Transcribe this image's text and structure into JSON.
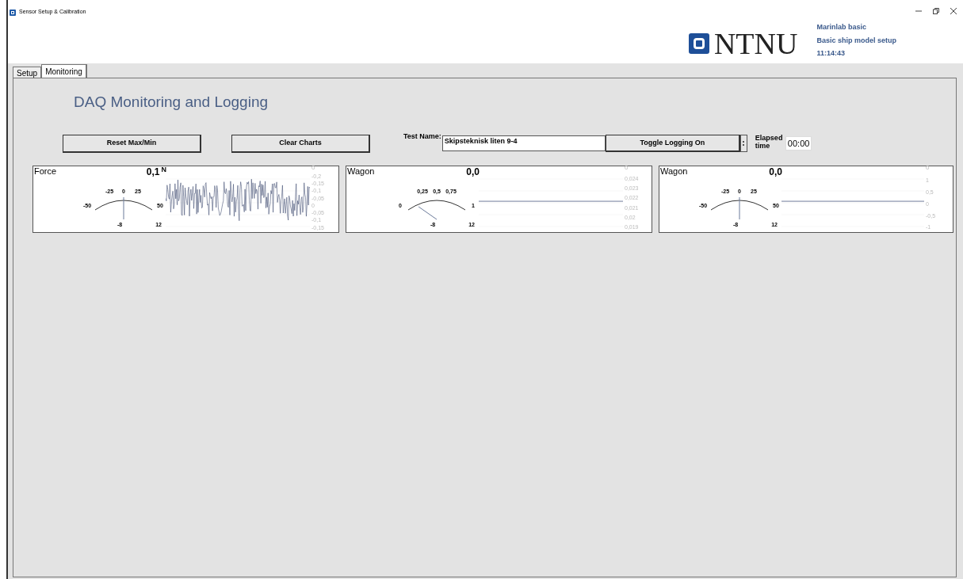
{
  "window": {
    "title": "Sensor Setup & Calibration"
  },
  "header": {
    "logo_text": "NTNU",
    "info": [
      "Marinlab basic",
      "Basic ship model setup",
      "11:14:43"
    ]
  },
  "tabs": [
    {
      "label": "Setup",
      "selected": false
    },
    {
      "label": "Monitoring",
      "selected": true
    }
  ],
  "page_title": "DAQ Monitoring and Logging",
  "toolbar": {
    "buttons": [
      "Reset Max/Min",
      "Clear Charts"
    ],
    "test_name_label": "Test Name:",
    "test_name_value": "Skipsteknisk liten 9-4",
    "toggle_button": "Toggle Logging On",
    "elapsed_label": "Elapsed time",
    "elapsed_value": "00:00"
  },
  "monitors": [
    {
      "title": "Force",
      "value": "0,1",
      "unit": "N",
      "gauge_ticks": [
        "-50",
        "-25",
        "0",
        "25",
        "50"
      ],
      "min": "-8",
      "max": "12",
      "corner_label": "0",
      "axis_labels": [
        "-0,2",
        "-0,15",
        "-0,1",
        "-0,05",
        "0",
        "-0,05",
        "-0,1",
        "-0,15"
      ],
      "kind": "live"
    },
    {
      "title": "Wagon",
      "value": "0,0",
      "gauge_ticks": [
        "0",
        "0,25",
        "0,5",
        "0,75",
        "1"
      ],
      "min": "-8",
      "max": "12",
      "corner_label": "0",
      "axis_labels": [
        "0,024",
        "0,023",
        "0,022",
        "0,021",
        "0,02",
        "0,019"
      ],
      "kind": "unsigned"
    },
    {
      "title": "Wagon",
      "value": "0,0",
      "gauge_ticks": [
        "-50",
        "-25",
        "0",
        "25",
        "50"
      ],
      "min": "-8",
      "max": "12",
      "corner_label": "0",
      "axis_labels": [
        "1",
        "0,5",
        "0",
        "-0,5",
        "-1"
      ],
      "kind": "signed"
    }
  ]
}
